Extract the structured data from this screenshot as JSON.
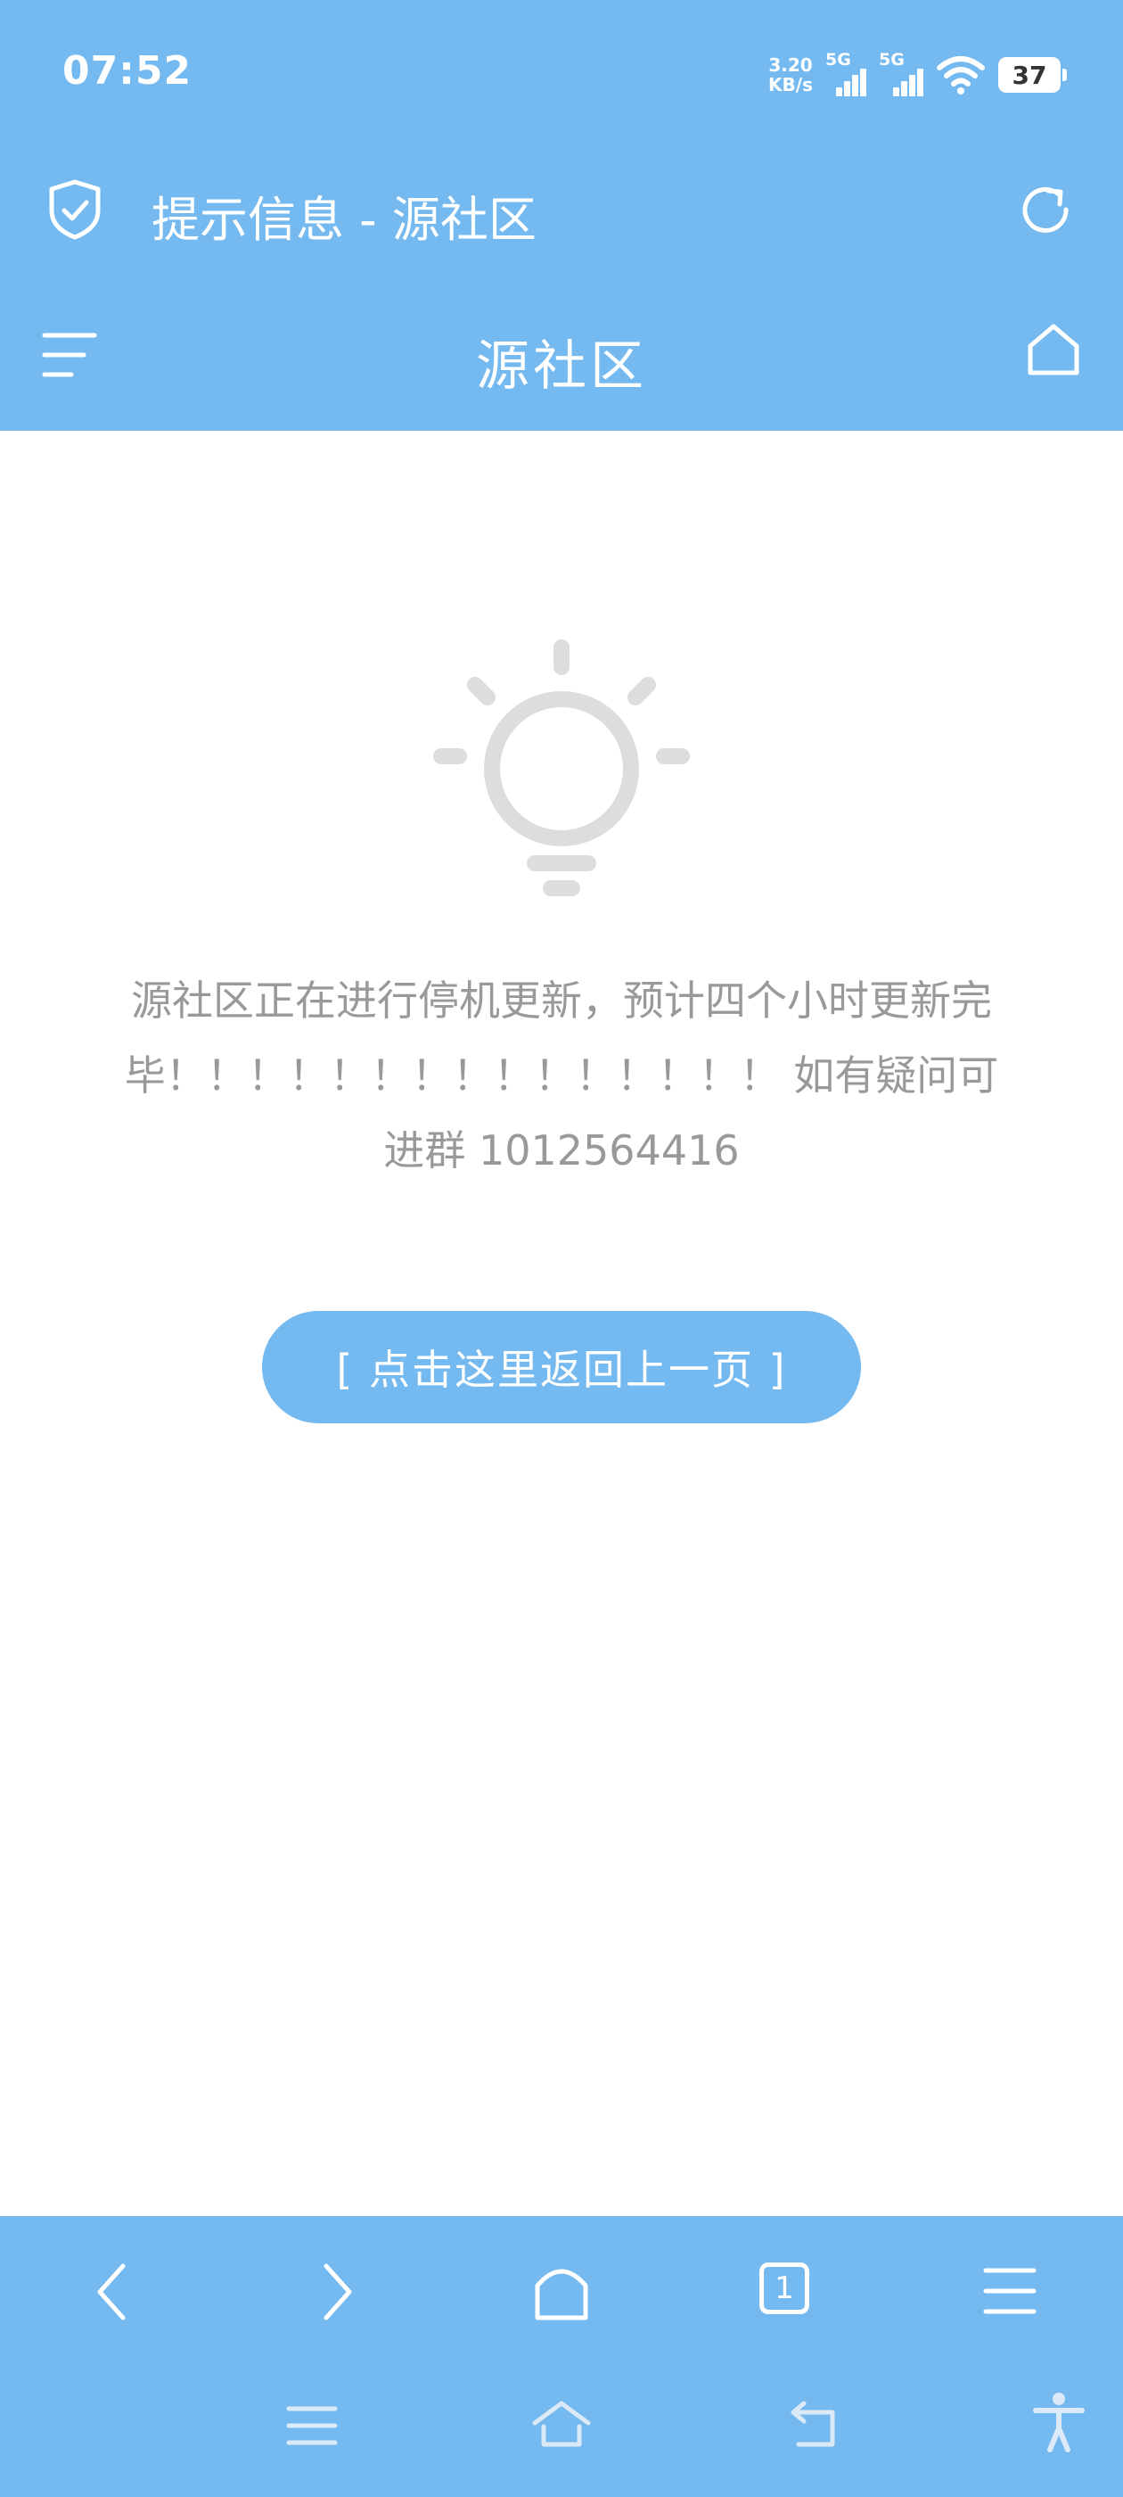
{
  "status_bar": {
    "time": "07:52",
    "speed_value": "3.20",
    "speed_unit": "KB/s",
    "signal1_label": "5G",
    "signal2_label": "5G",
    "battery": "37"
  },
  "title_bar": {
    "title": "提示信息 - 源社区"
  },
  "header": {
    "site_title": "源社区"
  },
  "content": {
    "message": "源社区正在进行停机更新，预计四个小时更新完毕！！！！！！！！！！！！！！！ 如有疑问可进群 1012564416",
    "back_button_label": "[ 点击这里返回上一页 ]"
  },
  "browser_toolbar": {
    "tab_count": "1"
  },
  "colors": {
    "accent": "#74b9ef",
    "icon_gray": "#dddddd",
    "text_gray": "#999999"
  }
}
